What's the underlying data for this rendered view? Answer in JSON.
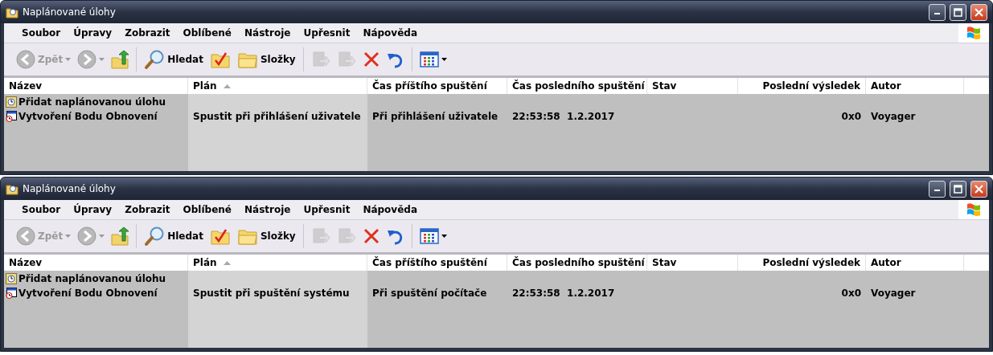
{
  "windows": [
    {
      "title": "Naplánované úlohy",
      "menu": [
        "Soubor",
        "Úpravy",
        "Zobrazit",
        "Oblíbené",
        "Nástroje",
        "Upřesnit",
        "Nápověda"
      ],
      "toolbar": [
        {
          "kind": "back",
          "label": "Zpět",
          "disabled": true
        },
        {
          "kind": "forward",
          "disabled": true
        },
        {
          "kind": "up",
          "disabled": false
        },
        {
          "kind": "separator"
        },
        {
          "kind": "search",
          "label": "Hledat",
          "disabled": false
        },
        {
          "kind": "tasks",
          "disabled": false
        },
        {
          "kind": "folders",
          "label": "Složky",
          "disabled": false
        },
        {
          "kind": "separator"
        },
        {
          "kind": "move",
          "disabled": true
        },
        {
          "kind": "copy",
          "disabled": true
        },
        {
          "kind": "delete",
          "disabled": false
        },
        {
          "kind": "undo",
          "disabled": false
        },
        {
          "kind": "separator"
        },
        {
          "kind": "views",
          "disabled": false
        }
      ],
      "columns": [
        {
          "label": "Název",
          "sorted": false
        },
        {
          "label": "Plán",
          "sorted": true
        },
        {
          "label": "Čas příštího spuštění",
          "sorted": false
        },
        {
          "label": "Čas posledního spuštění",
          "sorted": false
        },
        {
          "label": "Stav",
          "sorted": false
        },
        {
          "label": "Poslední výsledek",
          "sorted": false
        },
        {
          "label": "Autor",
          "sorted": false
        }
      ],
      "rows": [
        {
          "kind": "wizard",
          "cells": [
            "Přidat naplánovanou úlohu"
          ]
        },
        {
          "kind": "task",
          "cells": [
            "Vytvoření Bodu Obnovení",
            "Spustit při přihlášení uživatele",
            "Při přihlášení uživatele",
            "22:53:58  1.2.2017",
            "",
            "0x0",
            "Voyager"
          ]
        }
      ]
    },
    {
      "title": "Naplánované úlohy",
      "menu": [
        "Soubor",
        "Úpravy",
        "Zobrazit",
        "Oblíbené",
        "Nástroje",
        "Upřesnit",
        "Nápověda"
      ],
      "toolbar": [
        {
          "kind": "back",
          "label": "Zpět",
          "disabled": true
        },
        {
          "kind": "forward",
          "disabled": true
        },
        {
          "kind": "up",
          "disabled": false
        },
        {
          "kind": "separator"
        },
        {
          "kind": "search",
          "label": "Hledat",
          "disabled": false
        },
        {
          "kind": "tasks",
          "disabled": false
        },
        {
          "kind": "folders",
          "label": "Složky",
          "disabled": false
        },
        {
          "kind": "separator"
        },
        {
          "kind": "move",
          "disabled": true
        },
        {
          "kind": "copy",
          "disabled": true
        },
        {
          "kind": "delete",
          "disabled": false
        },
        {
          "kind": "undo",
          "disabled": false
        },
        {
          "kind": "separator"
        },
        {
          "kind": "views",
          "disabled": false
        }
      ],
      "columns": [
        {
          "label": "Název",
          "sorted": false
        },
        {
          "label": "Plán",
          "sorted": true
        },
        {
          "label": "Čas příštího spuštění",
          "sorted": false
        },
        {
          "label": "Čas posledního spuštění",
          "sorted": false
        },
        {
          "label": "Stav",
          "sorted": false
        },
        {
          "label": "Poslední výsledek",
          "sorted": false
        },
        {
          "label": "Autor",
          "sorted": false
        }
      ],
      "rows": [
        {
          "kind": "wizard",
          "cells": [
            "Přidat naplánovanou úlohu"
          ]
        },
        {
          "kind": "task",
          "cells": [
            "Vytvoření Bodu Obnovení",
            "Spustit při spuštění systému",
            "Při spuštění počítače",
            "22:53:58  1.2.2017",
            "",
            "0x0",
            "Voyager"
          ]
        }
      ]
    }
  ]
}
